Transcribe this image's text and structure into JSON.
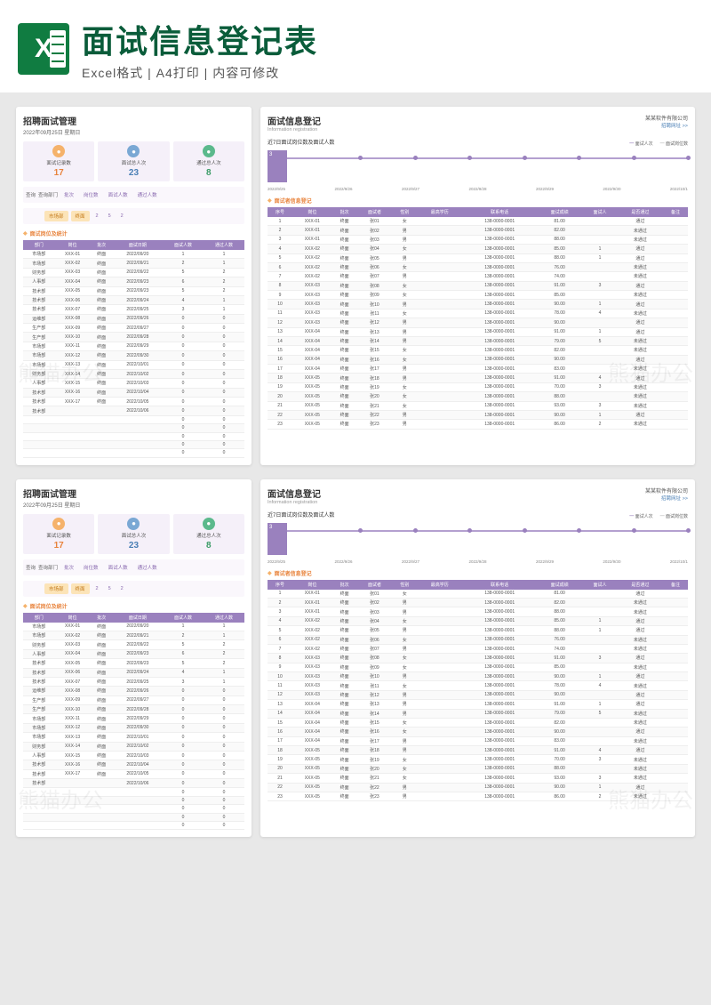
{
  "header": {
    "main_title": "面试信息登记表",
    "sub_title": "Excel格式 | A4打印 | 内容可修改",
    "excel_label": "X"
  },
  "left_panel": {
    "title": "招聘面试管理",
    "date_line": "2022年09月25日  星期日",
    "metrics": [
      {
        "icon": "record-icon",
        "label": "面试记录数",
        "value": "17",
        "cls": "orange"
      },
      {
        "icon": "total-icon",
        "label": "面试总人次",
        "value": "23",
        "cls": "blue"
      },
      {
        "icon": "pass-icon",
        "label": "通过总人次",
        "value": "8",
        "cls": "green"
      }
    ],
    "filter": {
      "query_label": "查询",
      "dept_label": "查询部门",
      "batch_label": "批次",
      "pos_label": "岗位数",
      "interview_label": "面试人数",
      "pass_label": "通过人数",
      "market": "市场部",
      "final": "终面",
      "v2a": "2",
      "v2b": "5",
      "v2c": "2"
    },
    "section": "面试岗位及统计",
    "table": {
      "headers": [
        "部门",
        "岗位",
        "批次",
        "面试日期",
        "面试人数",
        "通过人数"
      ],
      "rows": [
        [
          "市场部",
          "XXX-01",
          "终面",
          "2022/09/20",
          "1",
          "1"
        ],
        [
          "市场部",
          "XXX-02",
          "终面",
          "2022/09/21",
          "2",
          "1"
        ],
        [
          "财务部",
          "XXX-03",
          "终面",
          "2022/09/22",
          "5",
          "2"
        ],
        [
          "人事部",
          "XXX-04",
          "终面",
          "2022/09/23",
          "6",
          "2"
        ],
        [
          "技术部",
          "XXX-05",
          "终面",
          "2022/09/23",
          "5",
          "2"
        ],
        [
          "技术部",
          "XXX-06",
          "终面",
          "2022/09/24",
          "4",
          "1"
        ],
        [
          "技术部",
          "XXX-07",
          "终面",
          "2022/09/25",
          "3",
          "1"
        ],
        [
          "运维部",
          "XXX-08",
          "终面",
          "2022/09/26",
          "0",
          "0"
        ],
        [
          "生产部",
          "XXX-09",
          "终面",
          "2022/09/27",
          "0",
          "0"
        ],
        [
          "生产部",
          "XXX-10",
          "终面",
          "2022/09/28",
          "0",
          "0"
        ],
        [
          "市场部",
          "XXX-11",
          "终面",
          "2022/09/29",
          "0",
          "0"
        ],
        [
          "市场部",
          "XXX-12",
          "终面",
          "2022/09/30",
          "0",
          "0"
        ],
        [
          "市场部",
          "XXX-13",
          "终面",
          "2022/10/01",
          "0",
          "0"
        ],
        [
          "财务部",
          "XXX-14",
          "终面",
          "2022/10/02",
          "0",
          "0"
        ],
        [
          "人事部",
          "XXX-15",
          "终面",
          "2022/10/03",
          "0",
          "0"
        ],
        [
          "技术部",
          "XXX-16",
          "终面",
          "2022/10/04",
          "0",
          "0"
        ],
        [
          "技术部",
          "XXX-17",
          "终面",
          "2022/10/05",
          "0",
          "0"
        ],
        [
          "技术部",
          "",
          "",
          "2022/10/06",
          "0",
          "0"
        ],
        [
          "",
          "",
          "",
          "",
          "0",
          "0"
        ],
        [
          "",
          "",
          "",
          "",
          "0",
          "0"
        ],
        [
          "",
          "",
          "",
          "",
          "0",
          "0"
        ],
        [
          "",
          "",
          "",
          "",
          "0",
          "0"
        ],
        [
          "",
          "",
          "",
          "",
          "0",
          "0"
        ]
      ]
    }
  },
  "right_panel": {
    "title": "面试信息登记",
    "subtitle": "Information registration",
    "company": "某某软件有限公司",
    "link": "招聘网址 >>",
    "chart_title": "近7日面试岗位数及面试人数",
    "legend": [
      "面试人次",
      "面试岗位数"
    ],
    "section": "面试者信息登记",
    "table": {
      "headers": [
        "序号",
        "岗位",
        "批次",
        "面试者",
        "性别",
        "最高学历",
        "联系电话",
        "面试成绩",
        "面试人",
        "是否通过",
        "备注"
      ],
      "rows": [
        [
          "1",
          "XXX-01",
          "终面",
          "张01",
          "女",
          "",
          "138-0000-0001",
          "81.00",
          "",
          "通过",
          ""
        ],
        [
          "2",
          "XXX-01",
          "终面",
          "张02",
          "男",
          "",
          "138-0000-0001",
          "82.00",
          "",
          "未通过",
          ""
        ],
        [
          "3",
          "XXX-01",
          "终面",
          "张03",
          "男",
          "",
          "138-0000-0001",
          "88.00",
          "",
          "未通过",
          ""
        ],
        [
          "4",
          "XXX-02",
          "终面",
          "张04",
          "女",
          "",
          "138-0000-0001",
          "85.00",
          "1",
          "通过",
          ""
        ],
        [
          "5",
          "XXX-02",
          "终面",
          "张05",
          "男",
          "",
          "138-0000-0001",
          "88.00",
          "1",
          "通过",
          ""
        ],
        [
          "6",
          "XXX-02",
          "终面",
          "张06",
          "女",
          "",
          "138-0000-0001",
          "76.00",
          "",
          "未通过",
          ""
        ],
        [
          "7",
          "XXX-02",
          "终面",
          "张07",
          "男",
          "",
          "138-0000-0001",
          "74.00",
          "",
          "未通过",
          ""
        ],
        [
          "8",
          "XXX-03",
          "终面",
          "张08",
          "女",
          "",
          "138-0000-0001",
          "91.00",
          "3",
          "通过",
          ""
        ],
        [
          "9",
          "XXX-03",
          "终面",
          "张09",
          "女",
          "",
          "138-0000-0001",
          "85.00",
          "",
          "未通过",
          ""
        ],
        [
          "10",
          "XXX-03",
          "终面",
          "张10",
          "男",
          "",
          "138-0000-0001",
          "90.00",
          "1",
          "通过",
          ""
        ],
        [
          "11",
          "XXX-03",
          "终面",
          "张11",
          "女",
          "",
          "138-0000-0001",
          "78.00",
          "4",
          "未通过",
          ""
        ],
        [
          "12",
          "XXX-03",
          "终面",
          "张12",
          "男",
          "",
          "138-0000-0001",
          "90.00",
          "",
          "通过",
          ""
        ],
        [
          "13",
          "XXX-04",
          "终面",
          "张13",
          "男",
          "",
          "138-0000-0001",
          "91.00",
          "1",
          "通过",
          ""
        ],
        [
          "14",
          "XXX-04",
          "终面",
          "张14",
          "男",
          "",
          "138-0000-0001",
          "79.00",
          "5",
          "未通过",
          ""
        ],
        [
          "15",
          "XXX-04",
          "终面",
          "张15",
          "女",
          "",
          "138-0000-0001",
          "82.00",
          "",
          "未通过",
          ""
        ],
        [
          "16",
          "XXX-04",
          "终面",
          "张16",
          "女",
          "",
          "138-0000-0001",
          "90.00",
          "",
          "通过",
          ""
        ],
        [
          "17",
          "XXX-04",
          "终面",
          "张17",
          "男",
          "",
          "138-0000-0001",
          "83.00",
          "",
          "未通过",
          ""
        ],
        [
          "18",
          "XXX-05",
          "终面",
          "张18",
          "男",
          "",
          "138-0000-0001",
          "91.00",
          "4",
          "通过",
          ""
        ],
        [
          "19",
          "XXX-05",
          "终面",
          "张19",
          "女",
          "",
          "138-0000-0001",
          "70.00",
          "3",
          "未通过",
          ""
        ],
        [
          "20",
          "XXX-05",
          "终面",
          "张20",
          "女",
          "",
          "138-0000-0001",
          "88.00",
          "",
          "未通过",
          ""
        ],
        [
          "21",
          "XXX-05",
          "终面",
          "张21",
          "女",
          "",
          "138-0000-0001",
          "93.00",
          "3",
          "未通过",
          ""
        ],
        [
          "22",
          "XXX-05",
          "终面",
          "张22",
          "男",
          "",
          "138-0000-0001",
          "90.00",
          "1",
          "通过",
          ""
        ],
        [
          "23",
          "XXX-05",
          "终面",
          "张23",
          "男",
          "",
          "138-0000-0001",
          "86.00",
          "2",
          "未通过",
          ""
        ]
      ]
    }
  },
  "chart_data": {
    "type": "line",
    "title": "近7日面试岗位数及面试人数",
    "categories": [
      "2022/9/25",
      "2022/9/26",
      "2022/9/27",
      "2022/9/28",
      "2022/9/29",
      "2022/9/30",
      "2022/10/1"
    ],
    "series": [
      {
        "name": "面试人次",
        "values": [
          3,
          0,
          0,
          0,
          0,
          0,
          0
        ]
      },
      {
        "name": "面试岗位数",
        "values": [
          3,
          0,
          0,
          0,
          0,
          0,
          0
        ]
      }
    ],
    "ylim": [
      0,
      3
    ],
    "xlabel": "",
    "ylabel": ""
  }
}
